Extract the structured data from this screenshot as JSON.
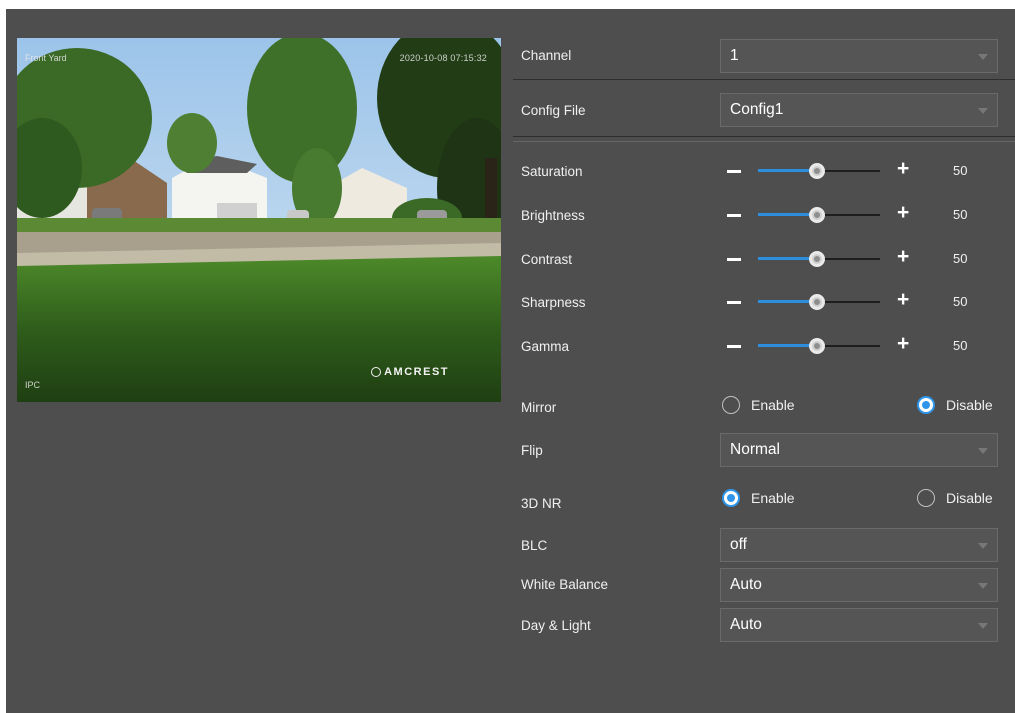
{
  "preview": {
    "osd_top_left": "Front Yard",
    "osd_top_right": "2020-10-08 07:15:32",
    "osd_bottom_left": "IPC",
    "brand": "AMCREST"
  },
  "settings": {
    "channel": {
      "label": "Channel",
      "value": "1"
    },
    "config_file": {
      "label": "Config File",
      "value": "Config1"
    },
    "sliders": [
      {
        "label": "Saturation",
        "value": 50
      },
      {
        "label": "Brightness",
        "value": 50
      },
      {
        "label": "Contrast",
        "value": 50
      },
      {
        "label": "Sharpness",
        "value": 50
      },
      {
        "label": "Gamma",
        "value": 50
      }
    ],
    "mirror": {
      "label": "Mirror",
      "enable_label": "Enable",
      "disable_label": "Disable",
      "selected": "Disable"
    },
    "flip": {
      "label": "Flip",
      "value": "Normal"
    },
    "nr3d": {
      "label": "3D NR",
      "enable_label": "Enable",
      "disable_label": "Disable",
      "selected": "Enable"
    },
    "blc": {
      "label": "BLC",
      "value": "off"
    },
    "white_balance": {
      "label": "White Balance",
      "value": "Auto"
    },
    "day_light": {
      "label": "Day & Light",
      "value": "Auto"
    }
  },
  "colors": {
    "panel_bg": "#4e4e4e",
    "accent": "#2d8ee0"
  }
}
